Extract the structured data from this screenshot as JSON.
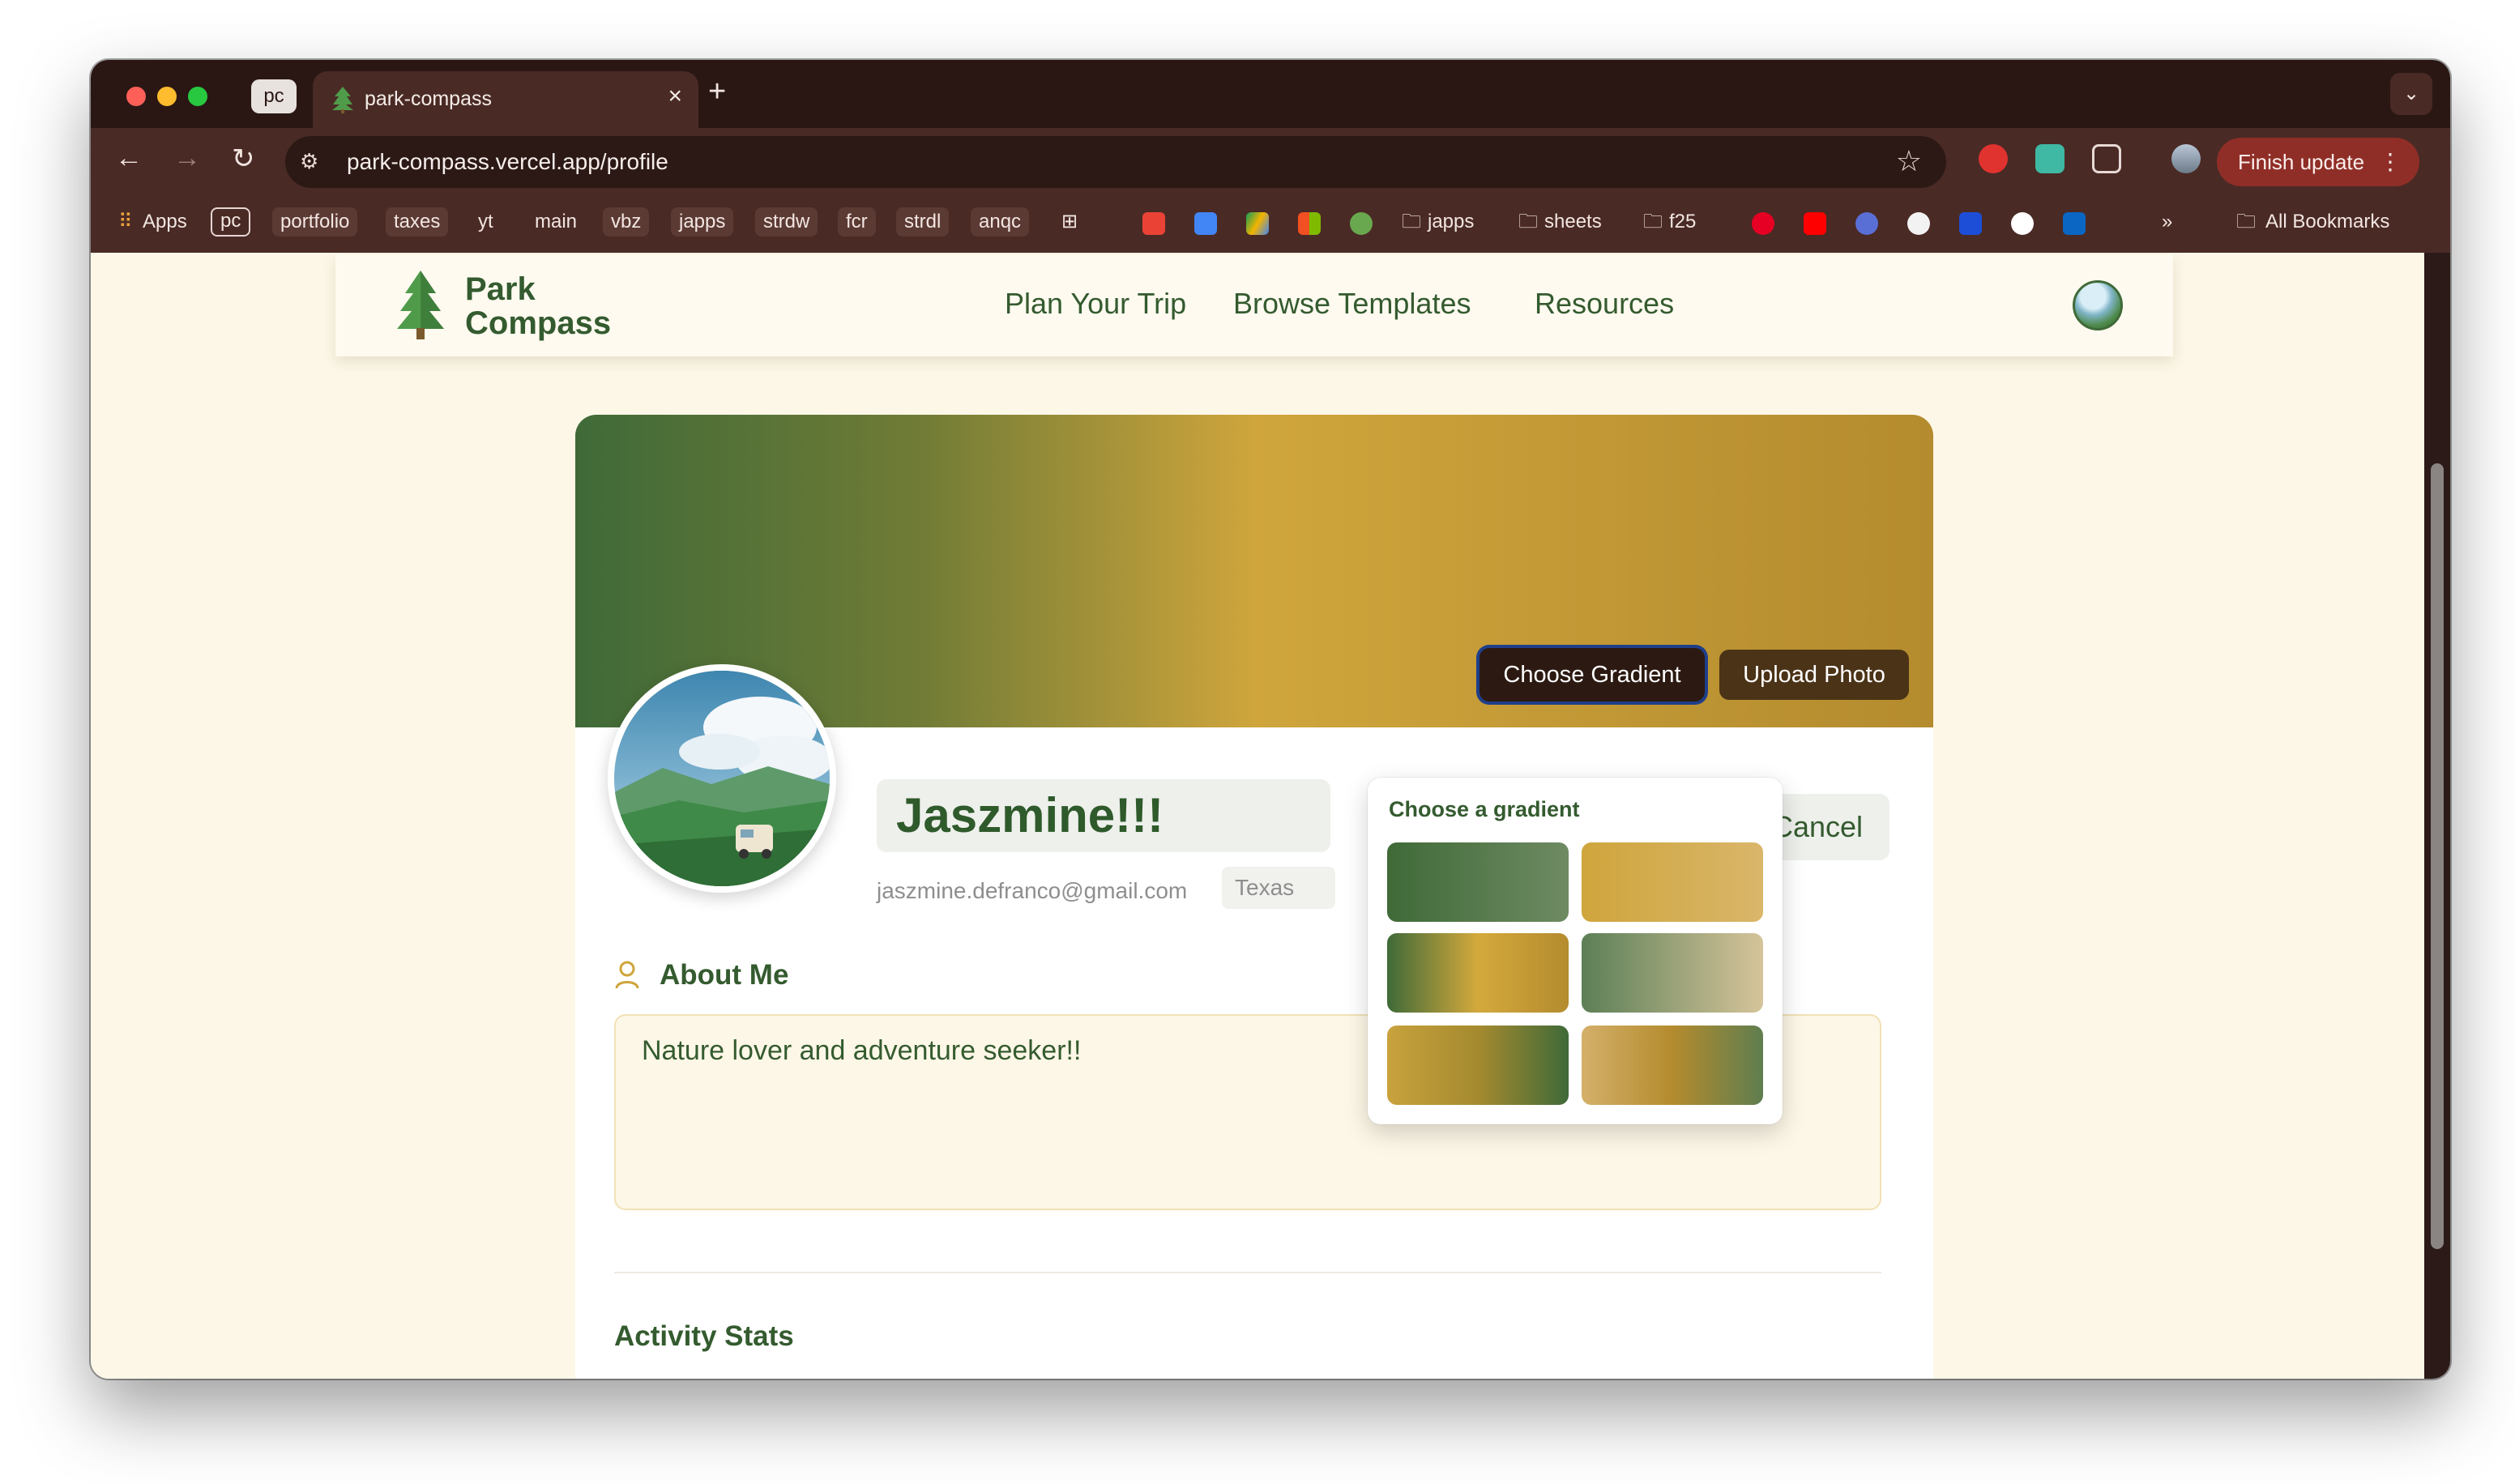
{
  "browser": {
    "pinned_tab_label": "pc",
    "active_tab_title": "park-compass",
    "url": "park-compass.vercel.app/profile",
    "finish_update_label": "Finish update",
    "bookmarks": [
      {
        "label": "Apps",
        "style": "plain"
      },
      {
        "label": "pc",
        "style": "outlined"
      },
      {
        "label": "portfolio",
        "style": "chip"
      },
      {
        "label": "taxes",
        "style": "chip"
      },
      {
        "label": "yt",
        "style": "plain"
      },
      {
        "label": "main",
        "style": "plain"
      },
      {
        "label": "vbz",
        "style": "chip"
      },
      {
        "label": "japps",
        "style": "chip"
      },
      {
        "label": "strdw",
        "style": "chip"
      },
      {
        "label": "fcr",
        "style": "chip"
      },
      {
        "label": "strdl",
        "style": "chip"
      },
      {
        "label": "anqc",
        "style": "chip"
      }
    ],
    "bookmark_folders": [
      "japps",
      "sheets",
      "f25"
    ],
    "all_bookmarks_label": "All Bookmarks",
    "overflow_label": "»"
  },
  "site": {
    "logo_line1": "Park",
    "logo_line2": "Compass",
    "nav": [
      "Plan Your Trip",
      "Browse Templates",
      "Resources"
    ]
  },
  "profile": {
    "choose_gradient_label": "Choose Gradient",
    "upload_photo_label": "Upload Photo",
    "name_value": "Jaszmine!!!",
    "cancel_label": "Cancel",
    "email": "jaszmine.defranco@gmail.com",
    "location": "Texas",
    "about_title": "About Me",
    "bio": "Nature lover and adventure seeker!!",
    "activity_title": "Activity Stats"
  },
  "gradient_picker": {
    "title": "Choose a gradient",
    "options": [
      {
        "from": "#3f6a38",
        "to": "#6e8a62"
      },
      {
        "from": "#cfa53c",
        "to": "#d9b66a"
      },
      {
        "from": "#3f6a38",
        "mid": "#d4a93c",
        "to": "#b48b2e"
      },
      {
        "from": "#5c7f56",
        "to": "#d6c49a"
      },
      {
        "from": "#c8a23d",
        "mid": "#a58a2f",
        "to": "#3f6a38"
      },
      {
        "from": "#d4b06a",
        "mid": "#b48b2e",
        "to": "#5f7e4f"
      }
    ]
  },
  "colors": {
    "brand_green": "#345b2f",
    "accent_gold": "#cfa53c",
    "page_bg": "#fdf7e7",
    "browser_chrome": "#4a2a25"
  }
}
